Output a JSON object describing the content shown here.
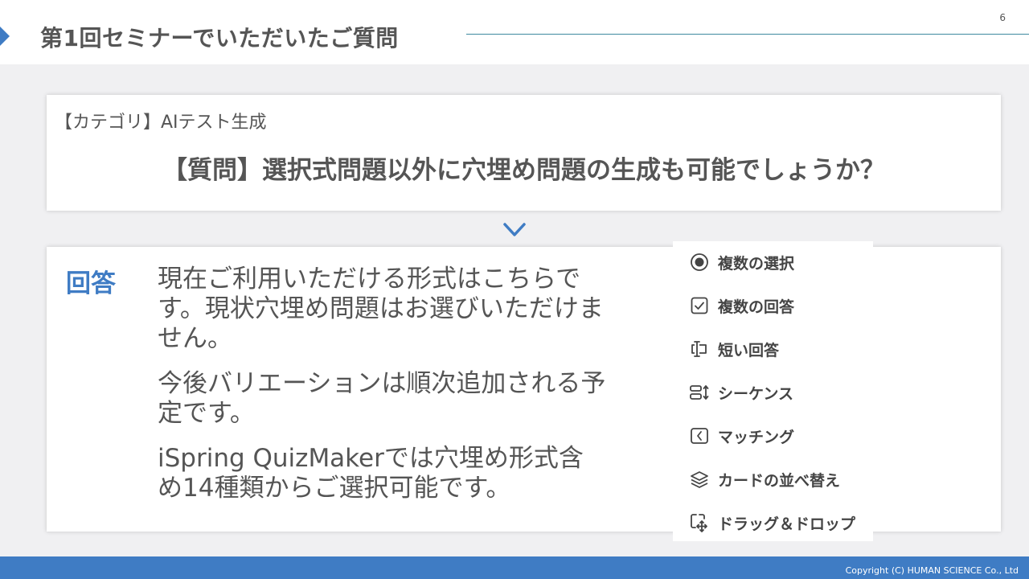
{
  "page": {
    "title": "第1回セミナーでいただいたご質問",
    "number": "6"
  },
  "question_card": {
    "category": "【カテゴリ】AIテスト生成",
    "question": "【質問】選択式問題以外に穴埋め問題の生成も可能でしょうか？"
  },
  "answer_card": {
    "label": "回答",
    "paragraphs": [
      "現在ご利用いただける形式はこちらです。現状穴埋め問題はお選びいただけません。",
      "今後バリエーションは順次追加される予定です。",
      "iSpring QuizMakerでは穴埋め形式含め14種類からご選択可能です。"
    ]
  },
  "question_types": [
    {
      "icon": "radio-button-icon",
      "label": "複数の選択"
    },
    {
      "icon": "checkbox-icon",
      "label": "複数の回答"
    },
    {
      "icon": "text-cursor-icon",
      "label": "短い回答"
    },
    {
      "icon": "sequence-icon",
      "label": "シーケンス"
    },
    {
      "icon": "matching-icon",
      "label": "マッチング"
    },
    {
      "icon": "layers-icon",
      "label": "カードの並べ替え"
    },
    {
      "icon": "drag-drop-icon",
      "label": "ドラッグ＆ドロップ"
    }
  ],
  "footer": {
    "copyright": "Copyright (C) HUMAN SCIENCE Co., Ltd"
  },
  "colors": {
    "accent": "#3f7cc4",
    "text": "#555555",
    "background": "#f0f0f2",
    "rule": "#3f8aa0"
  }
}
